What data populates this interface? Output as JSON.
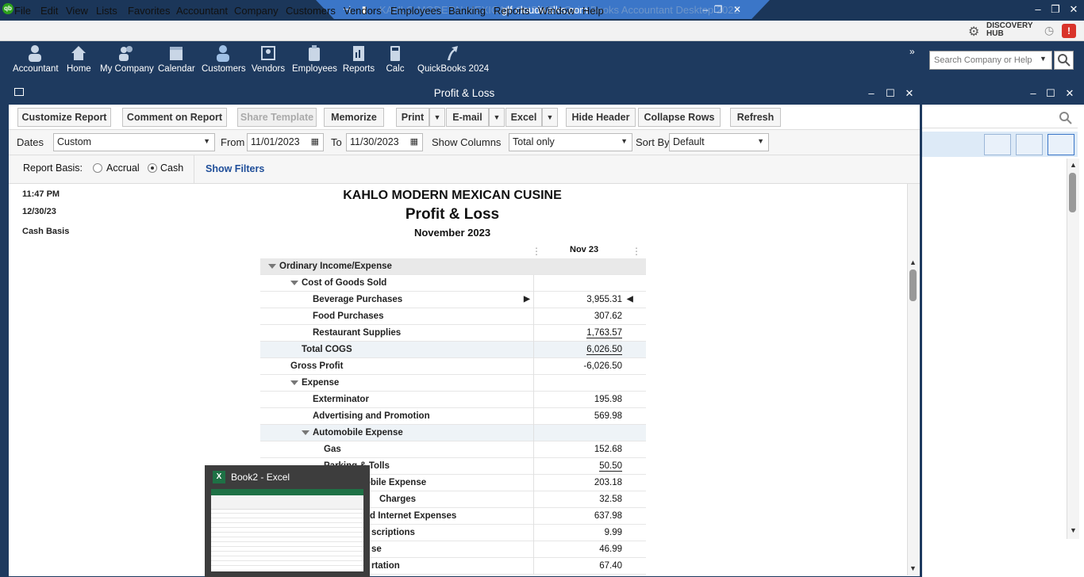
{
  "window": {
    "app_title_ghost": "KAHLO MODERN MEXICAN CUSINE - QuickBooks Accountant Desktop 2022",
    "remote_host": "glf.cloudwalks.com"
  },
  "menu": [
    "File",
    "Edit",
    "View",
    "Lists",
    "Favorites",
    "Accountant",
    "Company",
    "Customers",
    "Vendors",
    "Employees",
    "Banking",
    "Reports",
    "Window",
    "Help"
  ],
  "discovery": {
    "line1": "DISCOVERY",
    "line2": "HUB"
  },
  "toolbar": [
    "Accountant",
    "Home",
    "My Company",
    "Calendar",
    "Customers",
    "Vendors",
    "Employees",
    "Reports",
    "Calc",
    "QuickBooks 2024"
  ],
  "search": {
    "placeholder": "Search Company or Help"
  },
  "report_window": {
    "title": "Profit & Loss",
    "buttons": {
      "customize": "Customize Report",
      "comment": "Comment on Report",
      "share": "Share Template",
      "memorize": "Memorize",
      "print": "Print",
      "email": "E-mail",
      "excel": "Excel",
      "hide_header": "Hide Header",
      "collapse_rows": "Collapse Rows",
      "refresh": "Refresh"
    },
    "filters": {
      "dates_label": "Dates",
      "dates_value": "Custom",
      "from_label": "From",
      "from_value": "11/01/2023",
      "to_label": "To",
      "to_value": "11/30/2023",
      "columns_label": "Show Columns",
      "columns_value": "Total only",
      "sort_label": "Sort By",
      "sort_value": "Default"
    },
    "basis": {
      "label": "Report Basis:",
      "accrual": "Accrual",
      "cash": "Cash",
      "selected": "Cash",
      "show_filters": "Show Filters"
    }
  },
  "report": {
    "time": "11:47 PM",
    "date": "12/30/23",
    "basis": "Cash Basis",
    "company": "KAHLO MODERN MEXICAN CUSINE",
    "title": "Profit & Loss",
    "period": "November 2023",
    "column": "Nov 23",
    "rows": [
      {
        "label": "Ordinary Income/Expense",
        "value": ""
      },
      {
        "label": "Cost of Goods Sold",
        "value": ""
      },
      {
        "label": "Beverage Purchases",
        "value": "3,955.31"
      },
      {
        "label": "Food Purchases",
        "value": "307.62"
      },
      {
        "label": "Restaurant Supplies",
        "value": "1,763.57"
      },
      {
        "label": "Total COGS",
        "value": "6,026.50"
      },
      {
        "label": "Gross Profit",
        "value": "-6,026.50"
      },
      {
        "label": "Expense",
        "value": ""
      },
      {
        "label": "Exterminator",
        "value": "195.98"
      },
      {
        "label": "Advertising and Promotion",
        "value": "569.98"
      },
      {
        "label": "Automobile Expense",
        "value": ""
      },
      {
        "label": "Gas",
        "value": "152.68"
      },
      {
        "label": "Parking & Tolls",
        "value": "50.50"
      },
      {
        "label": "Total Automobile Expense",
        "value": "203.18"
      },
      {
        "label": "Charges",
        "value": "32.58"
      },
      {
        "label": "d Internet Expenses",
        "value": "637.98"
      },
      {
        "label": "scriptions",
        "value": "9.99"
      },
      {
        "label": "se",
        "value": "46.99"
      },
      {
        "label": "rtation",
        "value": "67.40"
      }
    ]
  },
  "excel_preview": {
    "title": "Book2 - Excel"
  }
}
